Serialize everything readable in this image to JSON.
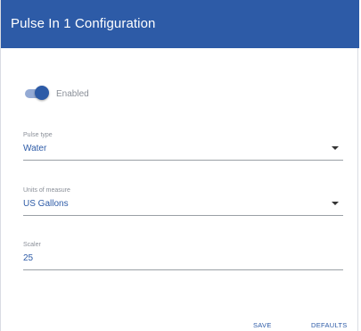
{
  "dialog": {
    "title": "Pulse In 1 Configuration",
    "accent_color": "#2d5ba7"
  },
  "enabled_toggle": {
    "label": "Enabled",
    "state": "on"
  },
  "fields": {
    "pulse_type": {
      "label": "Pulse type",
      "value": "Water"
    },
    "units": {
      "label": "Units of measure",
      "value": "US Gallons"
    },
    "scaler": {
      "label": "Scaler",
      "value": "25"
    }
  },
  "actions": {
    "save_label": "SAVE",
    "defaults_label": "DEFAULTS"
  }
}
